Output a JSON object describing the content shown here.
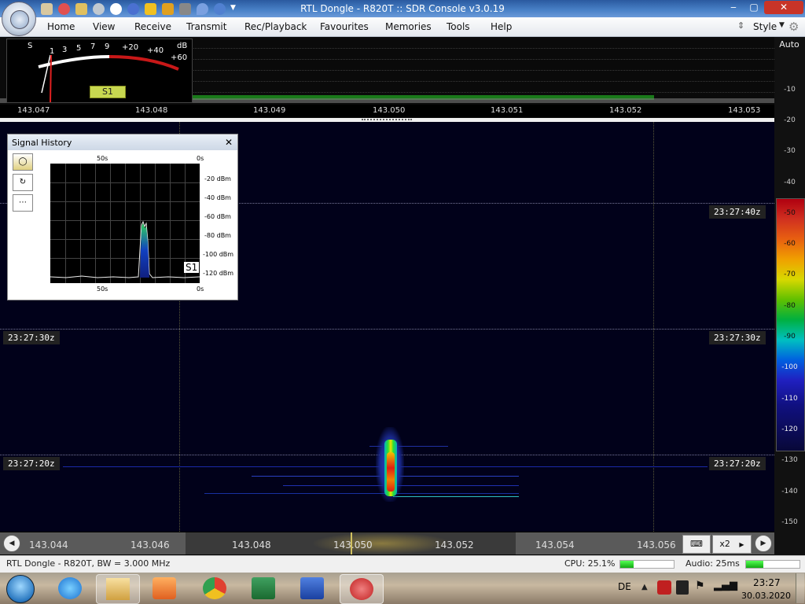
{
  "window": {
    "title": "RTL Dongle - R820T :: SDR Console v3.0.19",
    "controls": {
      "minimize": "‒",
      "restore": "▢",
      "close": "✕"
    }
  },
  "menu": {
    "items": [
      "Home",
      "View",
      "Receive",
      "Transmit",
      "Rec/Playback",
      "Favourites",
      "Memories",
      "Tools",
      "Help"
    ],
    "style_label": "Style"
  },
  "smeter": {
    "s_label": "S",
    "db_label": "dB",
    "scale_s": [
      "1",
      "3",
      "5",
      "7",
      "9"
    ],
    "scale_db": [
      "+20",
      "+40",
      "+60"
    ],
    "reading": "S1"
  },
  "spectrum": {
    "freq_ticks": [
      "143.047",
      "143.048",
      "143.049",
      "143.050",
      "143.051",
      "143.052",
      "143.053"
    ]
  },
  "scale": {
    "auto_label": "Auto",
    "db_labels": [
      "-10",
      "-20",
      "-30",
      "-40"
    ],
    "color_labels": [
      "-50",
      "-60",
      "-70",
      "-80",
      "-90",
      "-100",
      "-110",
      "-120"
    ],
    "lower_labels": [
      "-130",
      "-140",
      "-150"
    ]
  },
  "waterfall": {
    "timestamps": [
      "23:27:40z",
      "23:27:30z",
      "23:27:20z"
    ]
  },
  "signal_history": {
    "title": "Signal History",
    "close": "✕",
    "top_left": "50s",
    "top_right": "0s",
    "bottom_left": "50s",
    "bottom_right": "0s",
    "y_labels": [
      "-20 dBm",
      "-40 dBm",
      "-60 dBm",
      "-80 dBm",
      "-100 dBm",
      "-120 dBm"
    ],
    "reading": "S1"
  },
  "bottom_bar": {
    "freqs": [
      "143.044",
      "143.046",
      "143.048",
      "143.050",
      "143.052",
      "143.054",
      "143.056"
    ],
    "zoom": "x2"
  },
  "status": {
    "left": "RTL Dongle - R820T, BW = 3.000 MHz",
    "cpu": "CPU: 25.1%",
    "cpu_percent": 25.1,
    "audio": "Audio: 25ms"
  },
  "taskbar": {
    "lang": "DE",
    "time": "23:27",
    "date": "30.03.2020"
  }
}
